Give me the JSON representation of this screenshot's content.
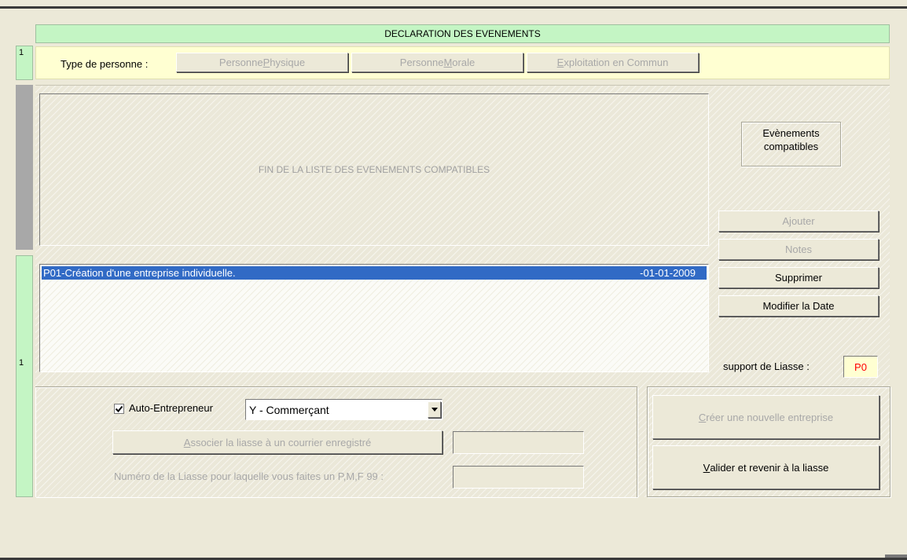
{
  "header": {
    "title": "DECLARATION DES EVENEMENTS"
  },
  "rows": {
    "top_number": "1",
    "bottom_number": "1"
  },
  "person_type": {
    "label": "Type de personne :",
    "buttons": [
      {
        "pre": "Personne ",
        "key": "P",
        "post": "hysique"
      },
      {
        "pre": "Personne ",
        "key": "M",
        "post": "orale"
      },
      {
        "pre": "",
        "key": "E",
        "post": "xploitation en Commun"
      }
    ]
  },
  "compatible_events": {
    "end_of_list_text": "FIN DE LA LISTE DES EVENEMENTS COMPATIBLES",
    "header_label": "Evènements compatibles"
  },
  "actions": {
    "add": "Ajouter",
    "notes": "Notes",
    "delete": "Supprimer",
    "modify_date": "Modifier la Date"
  },
  "selected_events": [
    {
      "label": "P01-Création d'une entreprise individuelle.",
      "date": "-01-01-2009"
    }
  ],
  "liasse": {
    "label": "support de Liasse :",
    "value": "P0"
  },
  "options": {
    "auto_entrepreneur_label": "Auto-Entrepreneur",
    "auto_entrepreneur_checked": true,
    "category_value": "Y - Commerçant",
    "associate_pre": "",
    "associate_key": "A",
    "associate_post": "ssocier la liasse à un courrier enregistré",
    "associate_field_value": "",
    "liasse_number_label": "Numéro de la Liasse pour laquelle vous faites un P,M,F 99 :",
    "liasse_number_value": ""
  },
  "bottom_actions": {
    "create_key": "C",
    "create_post": "réer une nouvelle entreprise",
    "validate_key": "V",
    "validate_post": "alider et revenir à la liasse"
  },
  "colors": {
    "green_band": "#c4f5c4",
    "yellow_band": "#ffffd2",
    "selection": "#316ac5",
    "liasse_box": "#ffffd2",
    "liasse_text": "#ff0000"
  }
}
